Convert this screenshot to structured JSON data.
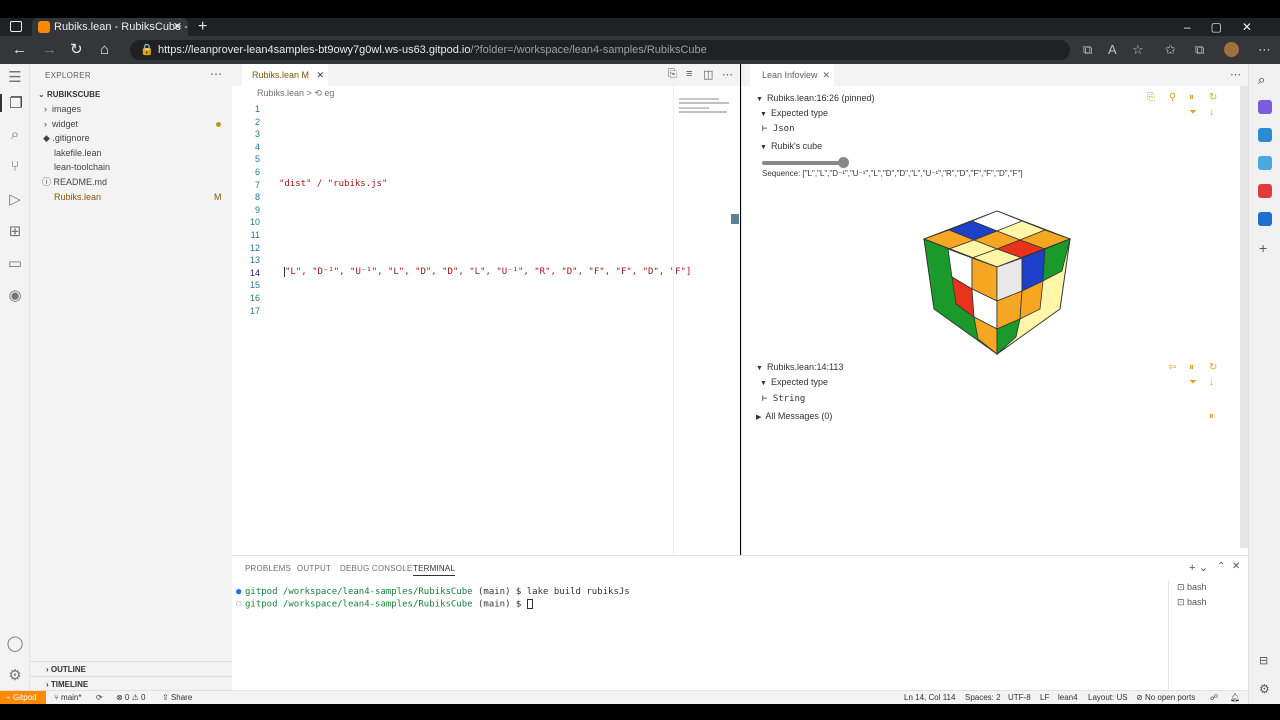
{
  "browser": {
    "tab_title": "Rubiks.lean - RubiksCube - Gitp",
    "url_main": "https://leanprover-lean4samples-bt9owy7g0wl.ws-us63.gitpod.io",
    "url_rest": "/?folder=/workspace/lean4-samples/RubiksCube"
  },
  "sidebar": {
    "header": "EXPLORER",
    "root": "RUBIKSCUBE",
    "items": [
      {
        "label": "images",
        "chevron": "›"
      },
      {
        "label": "widget",
        "chevron": "›"
      },
      {
        "label": ".gitignore"
      },
      {
        "label": "lakefile.lean"
      },
      {
        "label": "lean-toolchain"
      },
      {
        "label": "README.md"
      },
      {
        "label": "Rubiks.lean",
        "badge": "M"
      }
    ],
    "outline": "OUTLINE",
    "timeline": "TIMELINE"
  },
  "editor": {
    "tab_label": "Rubiks.lean",
    "tab_badge": "M",
    "crumb_file": "Rubiks.lean",
    "crumb_sep": ">",
    "crumb_symbol": "eg",
    "line_numbers": [
      "1",
      "2",
      "3",
      "4",
      "5",
      "6",
      "7",
      "8",
      "9",
      "10",
      "11",
      "12",
      "13",
      "14",
      "15",
      "16",
      "17"
    ],
    "line7": "\"dist\" / \"rubiks.js\"",
    "line14": "\"L\", \"D⁻¹\", \"U⁻¹\", \"L\", \"D\", \"D\", \"L\", \"U⁻¹\", \"R\", \"D\", \"F\", \"F\", \"D\", \"F\"]"
  },
  "infoview": {
    "tab_label": "Lean Infoview",
    "pinned_header": "Rubiks.lean:16:26 (pinned)",
    "expected_type_1": "Expected type",
    "type_1": "Json",
    "rubiks_cube": "Rubik's cube",
    "slider_position": 1.0,
    "sequence": "Sequence: [\"L\",\"L\",\"D⁻¹\",\"U⁻¹\",\"L\",\"D\",\"D\",\"L\",\"U⁻¹\",\"R\",\"D\",\"F\",\"F\",\"D\",\"F\"]",
    "second_header": "Rubiks.lean:14:113",
    "expected_type_2": "Expected type",
    "type_2": "String",
    "all_messages": "All Messages (0)"
  },
  "panel": {
    "tabs": [
      "PROBLEMS",
      "OUTPUT",
      "DEBUG CONSOLE",
      "TERMINAL"
    ],
    "active_tab": "TERMINAL",
    "term_line1_path": "gitpod /workspace/lean4-samples/RubiksCube",
    "term_line1_branch": " (main) $ ",
    "term_line1_cmd": "lake build rubiksJs",
    "term_line2_path": "gitpod /workspace/lean4-samples/RubiksCube",
    "term_line2_branch": " (main) $ ",
    "terminals": [
      "bash",
      "bash"
    ]
  },
  "statusbar": {
    "gitpod": "Gitpod",
    "branch": "main*",
    "errors": "⊗ 0 ⚠ 0",
    "share": "Share",
    "position": "Ln 14, Col 114",
    "spaces": "Spaces: 2",
    "encoding": "UTF-8",
    "eol": "LF",
    "lang": "lean4",
    "layout": "Layout: US",
    "ports": "No open ports"
  },
  "colors": {
    "gitpod_orange": "#ff8a00",
    "modified": "#895503",
    "string": "#a31515"
  }
}
